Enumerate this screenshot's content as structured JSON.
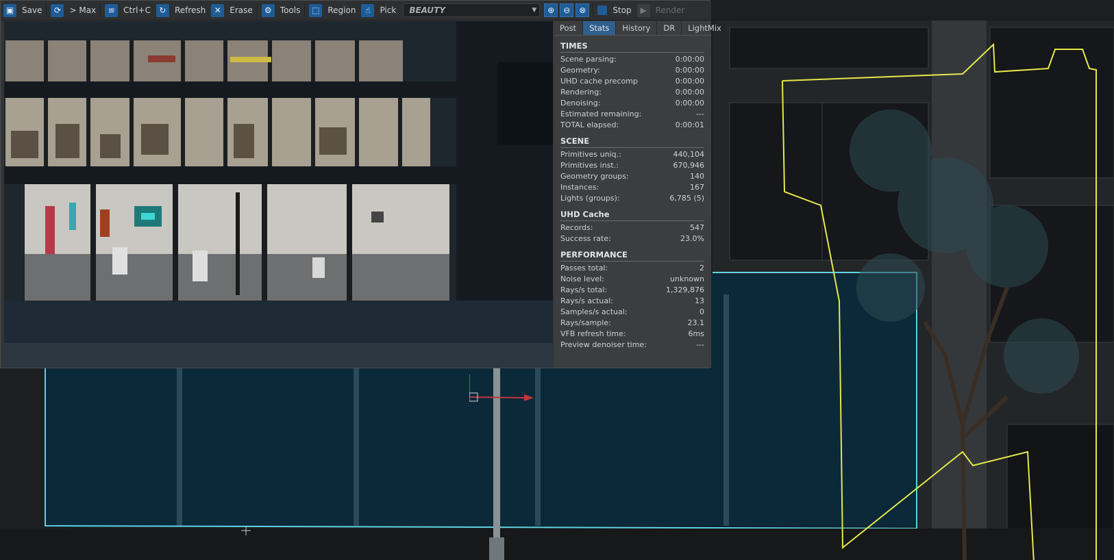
{
  "toolbar": {
    "save": "Save",
    "to_max": "> Max",
    "copy": "Ctrl+C",
    "refresh": "Refresh",
    "erase": "Erase",
    "tools": "Tools",
    "region": "Region",
    "pick": "Pick",
    "channel": "BEAUTY",
    "stop": "Stop",
    "render": "Render"
  },
  "stats_panel": {
    "tabs": [
      "Post",
      "Stats",
      "History",
      "DR",
      "LightMix"
    ],
    "active_tab": "Stats",
    "sections": [
      {
        "title": "TIMES",
        "rows": [
          {
            "label": "Scene parsing:",
            "value": "0:00:00"
          },
          {
            "label": "Geometry:",
            "value": "0:00:00"
          },
          {
            "label": "UHD cache precomp",
            "value": "0:00:00"
          },
          {
            "label": "Rendering:",
            "value": "0:00:00"
          },
          {
            "label": "Denoising:",
            "value": "0:00:00"
          },
          {
            "label": "Estimated remaining:",
            "value": "---"
          },
          {
            "label": "TOTAL elapsed:",
            "value": "0:00:01"
          }
        ]
      },
      {
        "title": "SCENE",
        "rows": [
          {
            "label": "Primitives uniq.:",
            "value": "440,104"
          },
          {
            "label": "Primitives inst.:",
            "value": "670,946"
          },
          {
            "label": "Geometry groups:",
            "value": "140"
          },
          {
            "label": "Instances:",
            "value": "167"
          },
          {
            "label": "Lights (groups):",
            "value": "6,785 (5)"
          }
        ]
      },
      {
        "title": "UHD Cache",
        "rows": [
          {
            "label": "Records:",
            "value": "547"
          },
          {
            "label": "Success rate:",
            "value": "23.0%"
          }
        ]
      },
      {
        "title": "PERFORMANCE",
        "rows": [
          {
            "label": "Passes total:",
            "value": "2"
          },
          {
            "label": "Noise level:",
            "value": "unknown"
          },
          {
            "label": "Rays/s total:",
            "value": "1,329,876"
          },
          {
            "label": "Rays/s actual:",
            "value": "13"
          },
          {
            "label": "Samples/s actual:",
            "value": "0"
          },
          {
            "label": "Rays/sample:",
            "value": "23.1"
          },
          {
            "label": "VFB refresh time:",
            "value": "6ms"
          },
          {
            "label": "Preview denoiser time:",
            "value": "---"
          }
        ]
      }
    ]
  },
  "colors": {
    "accent": "#1e5c96",
    "selection_yellow": "#e6e84a",
    "region_cyan": "#5fd3e0"
  }
}
